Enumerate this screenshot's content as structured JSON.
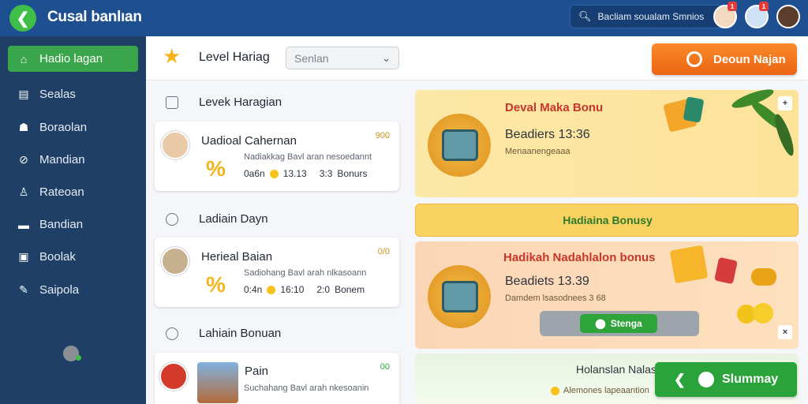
{
  "app": {
    "title": "Cusal banlıan"
  },
  "search": {
    "placeholder": "Bacliam soualam Smnios"
  },
  "topbar": {
    "badge1": "1",
    "badge2": "1"
  },
  "sidebar": {
    "items": [
      {
        "label": "Hadio lagan",
        "icon": "home-icon",
        "active": true
      },
      {
        "label": "Sealas",
        "icon": "doc-icon"
      },
      {
        "label": "Boraolan",
        "icon": "user-icon"
      },
      {
        "label": "Mandian",
        "icon": "link-icon"
      },
      {
        "label": "Rateoan",
        "icon": "person-icon"
      },
      {
        "label": "Bandian",
        "icon": "card-icon"
      },
      {
        "label": "Boolak",
        "icon": "image-icon"
      },
      {
        "label": "Saipola",
        "icon": "edit-icon"
      }
    ]
  },
  "header": {
    "level_title": "Level Hariag",
    "dropdown_value": "Senlan",
    "cta_label": "Deoun Najan"
  },
  "left": {
    "sections": [
      {
        "heading": "Levek Haragian",
        "icon": "folder-icon"
      },
      {
        "heading": "Ladiain Dayn",
        "icon": "clock-icon"
      },
      {
        "heading": "Lahiain Bonuan",
        "icon": "chevron-circle-icon"
      }
    ],
    "cards": [
      {
        "title": "Uadioal Cahernan",
        "num": "900",
        "desc": "Nadiakkag Bavl aran nesoedannt",
        "pct": "%",
        "meta1": "0a6n",
        "meta2": "13.13",
        "meta3": "3:3",
        "meta4": "Bonurs"
      },
      {
        "title": "Herieal Baian",
        "num": "0/0",
        "desc": "Sadiohang Bavl arah nlkasoann",
        "pct": "%",
        "meta1": "0:4n",
        "meta2": "16:10",
        "meta3": "2:0",
        "meta4": "Bonem"
      },
      {
        "title": "Pain",
        "num": "00",
        "desc": "Suchahang Bavl arah nkesoanin"
      }
    ]
  },
  "promos": [
    {
      "title": "Deval Maka Bonu",
      "amount": "Beadiers 13:36",
      "sub": "Menaanengeaaa"
    },
    {
      "title": "Hadiaina Bonusy"
    },
    {
      "title": "Hadikah Nadahlalon bonus",
      "amount": "Beadiets 13.39",
      "sub": "Damdem lsasodnees 3 68",
      "button": "Stenga"
    },
    {
      "title": "Holanslan Nalas",
      "sub": "Alemones lapeaantion",
      "button": "Slummay"
    }
  ]
}
